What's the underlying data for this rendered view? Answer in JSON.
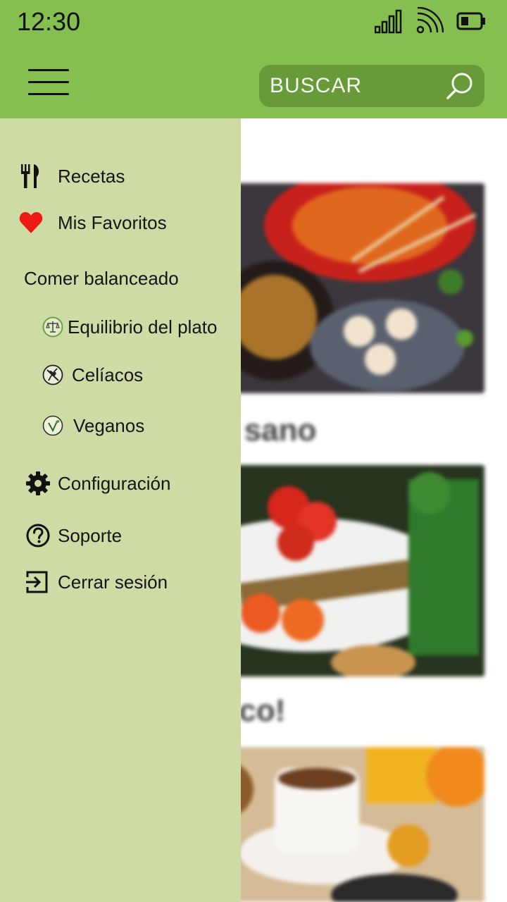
{
  "status_bar": {
    "time": "12:30"
  },
  "search": {
    "placeholder": "BUSCAR"
  },
  "drawer": {
    "recetas": "Recetas",
    "favoritos": "Mis Favoritos",
    "section_title": "Comer balanceado",
    "equilibrio": "Equilibrio del plato",
    "celiacos": "Celíacos",
    "veganos": "Veganos",
    "configuracion": "Configuración",
    "soporte": "Soporte",
    "cerrar_sesion": "Cerrar sesión"
  },
  "content": {
    "card1_title_partial": "é sano",
    "card2_title_partial": "rico!"
  },
  "icons": {
    "menu": "hamburger-icon",
    "search": "search-icon",
    "recetas": "fork-knife-icon",
    "favoritos": "heart-icon",
    "equilibrio": "scale-icon",
    "celiacos": "gluten-free-icon",
    "veganos": "vegan-icon",
    "configuracion": "gear-icon",
    "soporte": "help-icon",
    "cerrar_sesion": "logout-icon"
  },
  "colors": {
    "appbar": "#84bf4f",
    "search_bg": "#689a3a",
    "drawer_bg": "#cfdba4",
    "heart": "#e8150f"
  }
}
